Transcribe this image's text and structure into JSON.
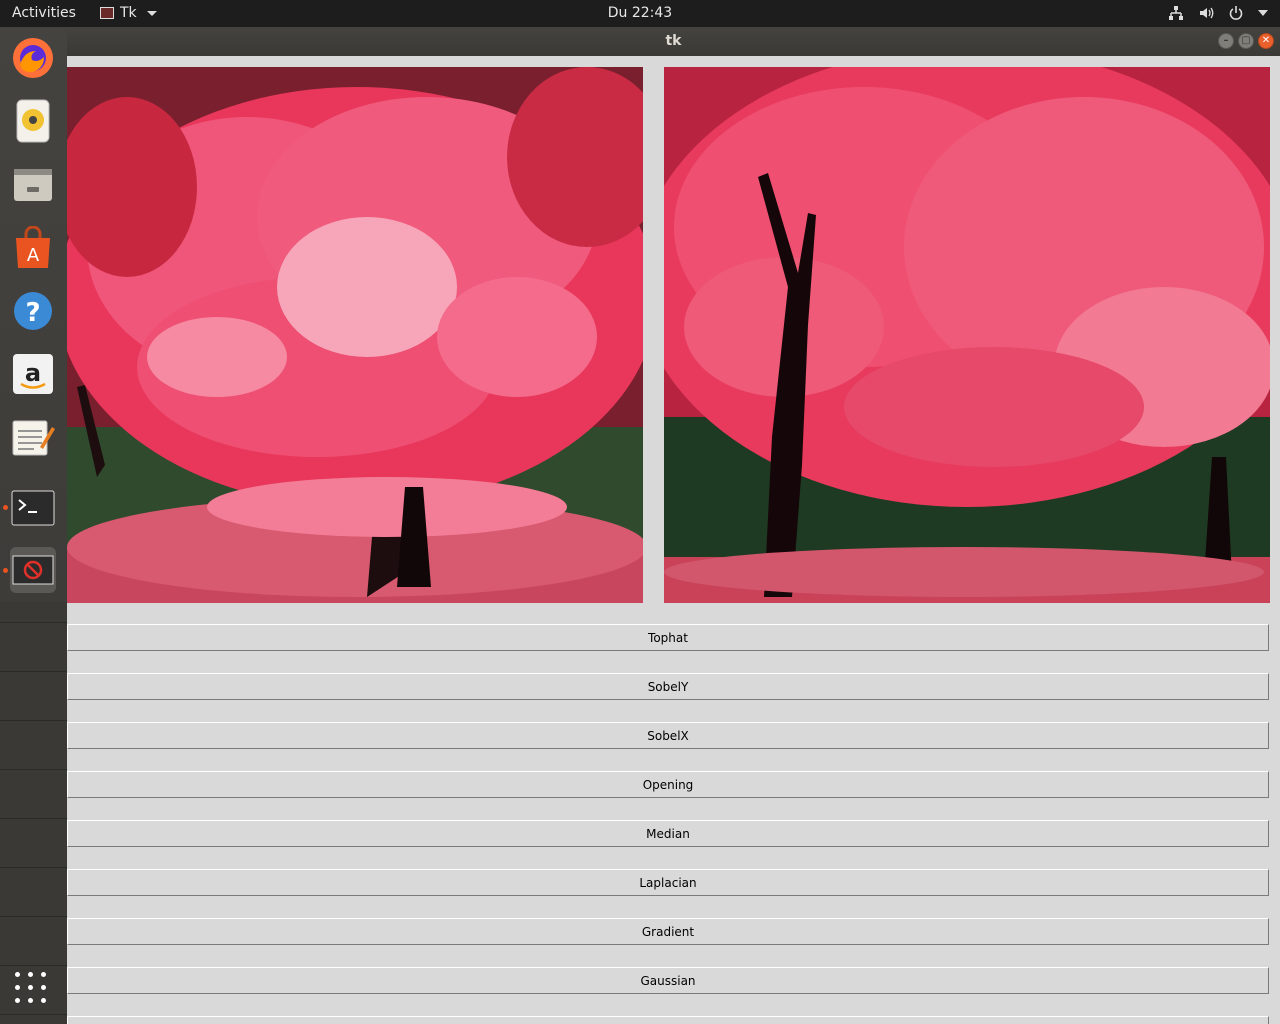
{
  "topbar": {
    "activities": "Activities",
    "app_name": "Tk",
    "clock": "Du 22:43"
  },
  "window": {
    "title": "tk"
  },
  "dock": {
    "items": [
      {
        "name": "firefox-icon"
      },
      {
        "name": "rhythmbox-icon"
      },
      {
        "name": "files-icon"
      },
      {
        "name": "software-icon"
      },
      {
        "name": "help-icon"
      },
      {
        "name": "amazon-icon"
      },
      {
        "name": "text-editor-icon"
      },
      {
        "name": "terminal-icon"
      },
      {
        "name": "tk-app-icon"
      }
    ]
  },
  "buttons": [
    {
      "label": "Tophat"
    },
    {
      "label": "SobelY"
    },
    {
      "label": "SobelX"
    },
    {
      "label": "Opening"
    },
    {
      "label": "Median"
    },
    {
      "label": "Laplacian"
    },
    {
      "label": "Gradient"
    },
    {
      "label": "Gaussian"
    }
  ],
  "colors": {
    "accent": "#e95420",
    "window_bg": "#d9d9d9",
    "foliage": "#e8375a"
  }
}
